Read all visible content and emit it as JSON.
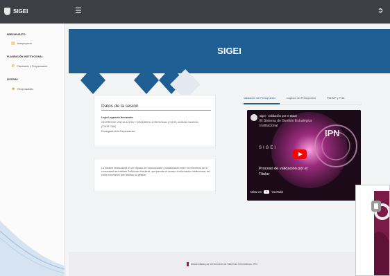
{
  "app": {
    "name": "SIGEI"
  },
  "topbar": {
    "menu_icon": "hamburger-icon",
    "logout_icon": "logout-icon"
  },
  "sidebar": {
    "sections": [
      {
        "title": "PRESUPUESTO",
        "items": [
          {
            "label": "Anteproyecto",
            "icon": "document-icon"
          }
        ]
      },
      {
        "title": "PLANEACIÓN INSTITUCIONAL",
        "items": [
          {
            "label": "Planeación y Programación",
            "icon": "gear-icon"
          }
        ]
      },
      {
        "title": "SISTEMA",
        "items": [
          {
            "label": "Responsables",
            "icon": "user-icon"
          }
        ]
      }
    ]
  },
  "header": {
    "title": "SIGEI"
  },
  "session": {
    "title": "Datos de la sesión",
    "user_name": "Leyla Legarreta Hernández",
    "unit_line1": "CENTRO DE VINCULACIÓN Y DESARROLLO REGIONAL (CVDR) UNIDAD CANCÚN",
    "unit_line2": "(CVDR CAN)",
    "role": "Encargada de la Dependencia"
  },
  "info": {
    "text": "La Intranet Institucional es un espacio de comunicación y colaboración entre los miembros de la comunidad del Instituto Politécnico Nacional, que permite el acceso a información institucional, así como a servicios que facilitan su gestión."
  },
  "tabs": [
    {
      "label": "Validación del Presupuesto",
      "active": true
    },
    {
      "label": "Captura del Presupuesto",
      "active": false
    },
    {
      "label": "PEDMP y POA",
      "active": false
    }
  ],
  "video": {
    "title": "sigei - validación por el titular",
    "subtitle_line1": "El Sistema de Gestión Estratégica",
    "subtitle_line2": "Institucional",
    "brand": "SIGEI",
    "caption_line1": "Proceso de validación por el",
    "caption_line2": "Titular",
    "watch_label": "Mirar en",
    "platform": "YouTube",
    "logo_text": "IPN"
  },
  "footer": {
    "text": "Desarrollado por la Dirección de Sistemas Informáticos. IPN"
  },
  "colors": {
    "topbar": "#3d3f44",
    "header": "#1f5e92",
    "accent_orange": "#e8a32e",
    "guinda": "#8b1d4f"
  }
}
